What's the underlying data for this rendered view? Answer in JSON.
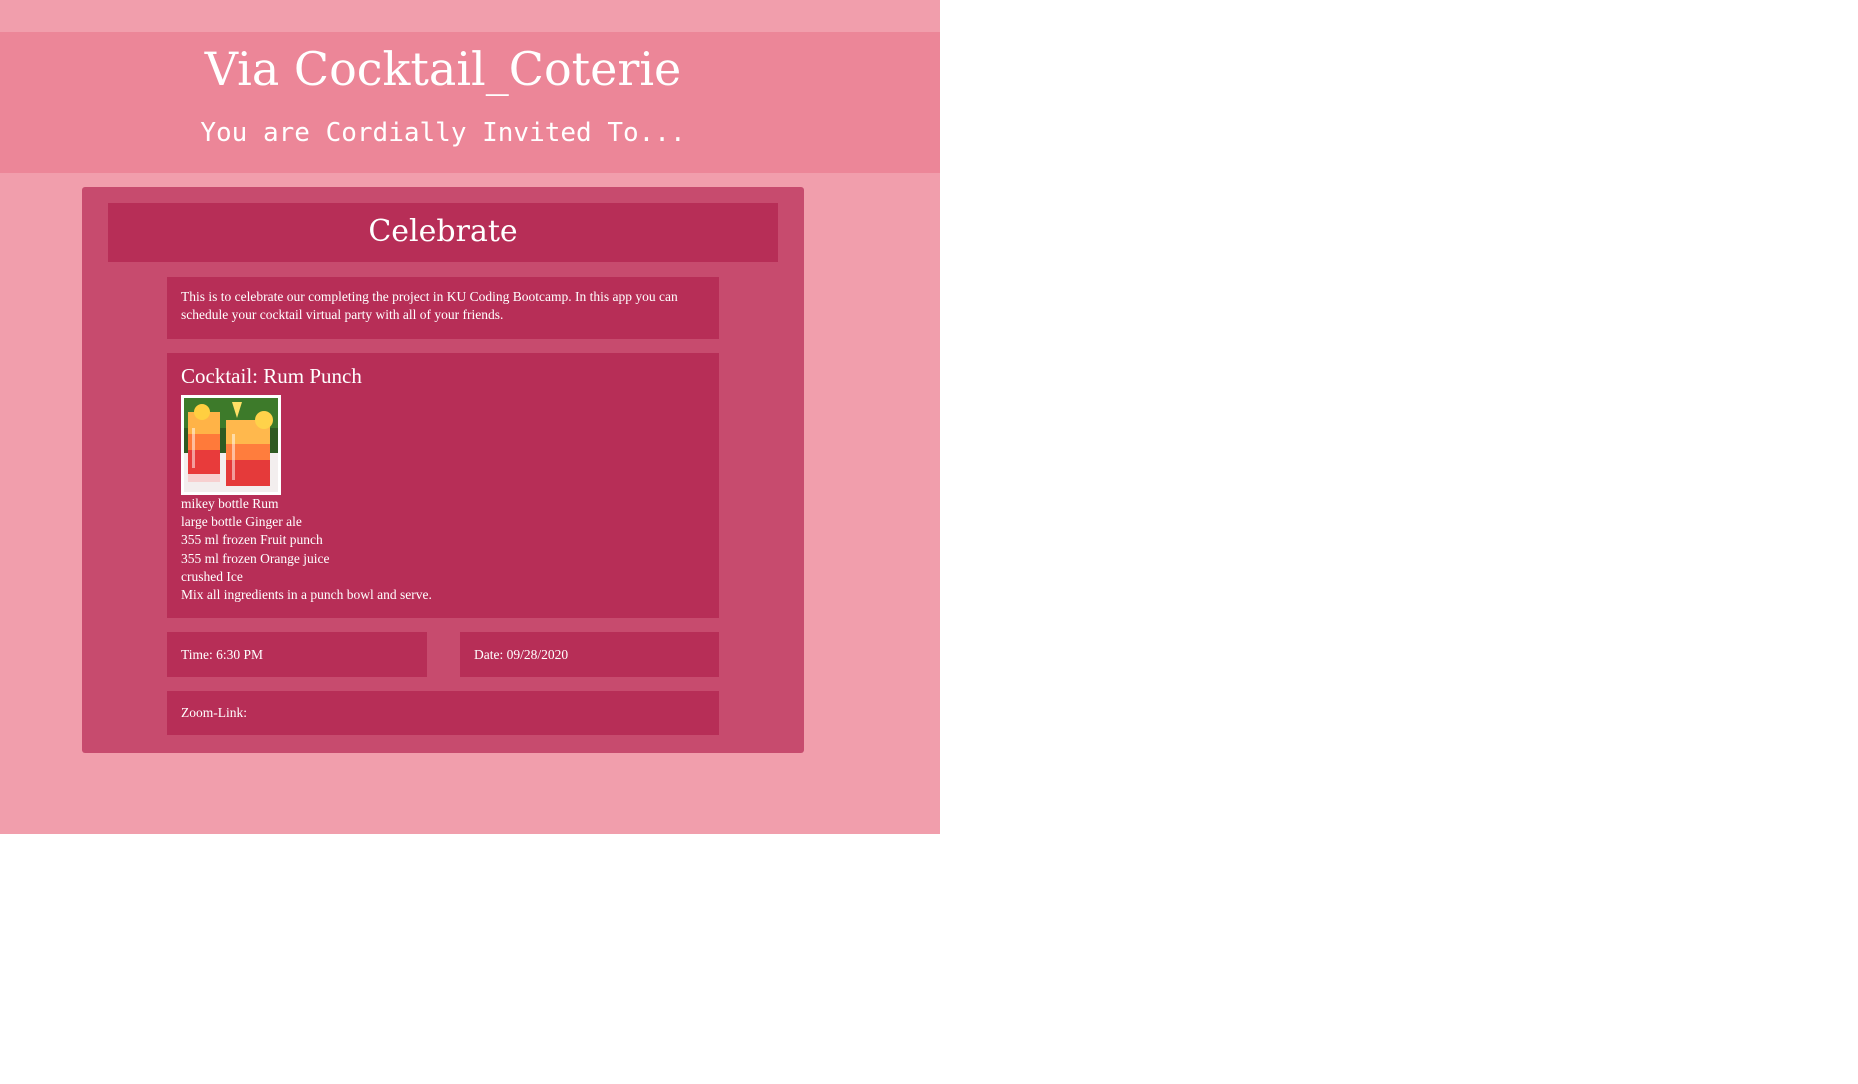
{
  "header": {
    "title": "Via Cocktail_Coterie",
    "subtitle": "You are Cordially Invited To..."
  },
  "card": {
    "title": "Celebrate",
    "intro": "This is to celebrate our completing the project in KU Coding Bootcamp. In this app you can schedule your cocktail virtual party with all of your friends.",
    "cocktail": {
      "title": "Cocktail: Rum Punch",
      "image_alt": "rum-punch-drink-photo",
      "lines": [
        "mikey bottle Rum",
        "large bottle Ginger ale",
        "355 ml frozen Fruit punch",
        "355 ml frozen Orange juice",
        "crushed Ice",
        "Mix all ingredients in a punch bowl and serve."
      ]
    },
    "time": "Time: 6:30 PM",
    "date": "Date: 09/28/2020",
    "zoom": "Zoom-Link:"
  },
  "colors": {
    "page_bg": "#f19eac",
    "header_bg": "#ec8698",
    "card_bg": "#c74b6e",
    "box_bg": "#b72e57",
    "text": "#ffffff"
  }
}
